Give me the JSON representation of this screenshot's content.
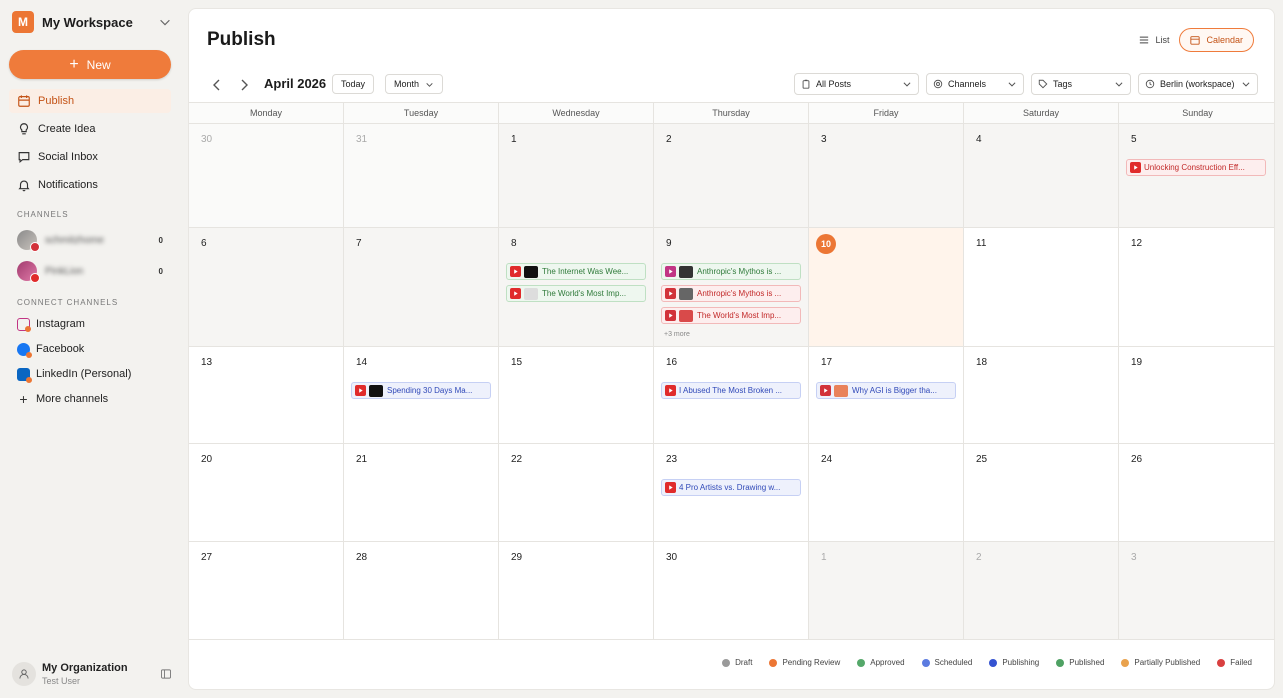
{
  "workspace": {
    "initial": "M",
    "name": "My Workspace"
  },
  "sidebar": {
    "new_label": "New",
    "nav": [
      {
        "label": "Publish",
        "icon": "calendar-icon",
        "active": true
      },
      {
        "label": "Create Idea",
        "icon": "lightbulb-icon"
      },
      {
        "label": "Social Inbox",
        "icon": "chat-icon"
      },
      {
        "label": "Notifications",
        "icon": "bell-icon"
      }
    ],
    "channels_title": "CHANNELS",
    "channels": [
      {
        "name": "schmitzhome",
        "network": "pinterest",
        "count": "0"
      },
      {
        "name": "PinkLion",
        "network": "youtube",
        "count": "0"
      }
    ],
    "connect_title": "CONNECT CHANNELS",
    "connect": [
      {
        "label": "Instagram",
        "icon": "instagram-icon"
      },
      {
        "label": "Facebook",
        "icon": "facebook-icon"
      },
      {
        "label": "LinkedIn (Personal)",
        "icon": "linkedin-icon"
      },
      {
        "label": "More channels",
        "icon": "plus-icon"
      }
    ],
    "org": {
      "name": "My Organization",
      "user": "Test User"
    }
  },
  "header": {
    "title": "Publish",
    "view_list": "List",
    "view_calendar": "Calendar"
  },
  "toolbar": {
    "month": "April 2026",
    "today": "Today",
    "range": "Month",
    "filter_posts": "All Posts",
    "filter_channels": "Channels",
    "filter_tags": "Tags",
    "timezone": "Berlin (workspace)"
  },
  "calendar": {
    "weekdays": [
      "Monday",
      "Tuesday",
      "Wednesday",
      "Thursday",
      "Friday",
      "Saturday",
      "Sunday"
    ],
    "weeks": [
      [
        "30",
        "31",
        "1",
        "2",
        "3",
        "4",
        "5"
      ],
      [
        "6",
        "7",
        "8",
        "9",
        "10",
        "11",
        "12"
      ],
      [
        "13",
        "14",
        "15",
        "16",
        "17",
        "18",
        "19"
      ],
      [
        "20",
        "21",
        "22",
        "23",
        "24",
        "25",
        "26"
      ],
      [
        "27",
        "28",
        "29",
        "30",
        "1",
        "2",
        "3"
      ]
    ],
    "today": "10",
    "more_label": "+3 more",
    "events": {
      "w0d6": [
        {
          "title": "Unlocking Construction Eff...",
          "status": "failed",
          "network": "youtube"
        }
      ],
      "w1d2": [
        {
          "title": "The Internet Was Wee...",
          "status": "published",
          "network": "youtube",
          "thumb": "#111111"
        },
        {
          "title": "The World's Most Imp...",
          "status": "published",
          "network": "youtube",
          "thumb": "#dddddd"
        }
      ],
      "w1d3": [
        {
          "title": "Anthropic's Mythos is ...",
          "status": "published",
          "network": "instagram",
          "thumb": "#333333"
        },
        {
          "title": "Anthropic's Mythos is ...",
          "status": "failed",
          "network": "pinterest",
          "thumb": "#666666"
        },
        {
          "title": "The World's Most Imp...",
          "status": "failed",
          "network": "pinterest",
          "thumb": "#d94a4a"
        }
      ],
      "w2d1": [
        {
          "title": "Spending 30 Days Ma...",
          "status": "scheduled",
          "network": "youtube",
          "thumb": "#111111"
        }
      ],
      "w2d3": [
        {
          "title": "I Abused The Most Broken ...",
          "status": "scheduled",
          "network": "youtube"
        }
      ],
      "w2d4": [
        {
          "title": "Why AGI is Bigger tha...",
          "status": "scheduled",
          "network": "pinterest",
          "thumb": "#e9825b"
        }
      ],
      "w3d3": [
        {
          "title": "4 Pro Artists vs. Drawing w...",
          "status": "scheduled",
          "network": "youtube"
        }
      ]
    }
  },
  "legend": [
    {
      "label": "Draft",
      "color": "#9a9a9a"
    },
    {
      "label": "Pending Review",
      "color": "#ec7634"
    },
    {
      "label": "Approved",
      "color": "#55a86a"
    },
    {
      "label": "Scheduled",
      "color": "#5b7be0"
    },
    {
      "label": "Publishing",
      "color": "#3453d1"
    },
    {
      "label": "Published",
      "color": "#4fa163"
    },
    {
      "label": "Partially Published",
      "color": "#e9a24d"
    },
    {
      "label": "Failed",
      "color": "#d94040"
    }
  ],
  "colors": {
    "accent": "#ef7b3b",
    "youtube": "#e02b2b",
    "pinterest": "#d2323a",
    "instagram": "#c13584"
  }
}
